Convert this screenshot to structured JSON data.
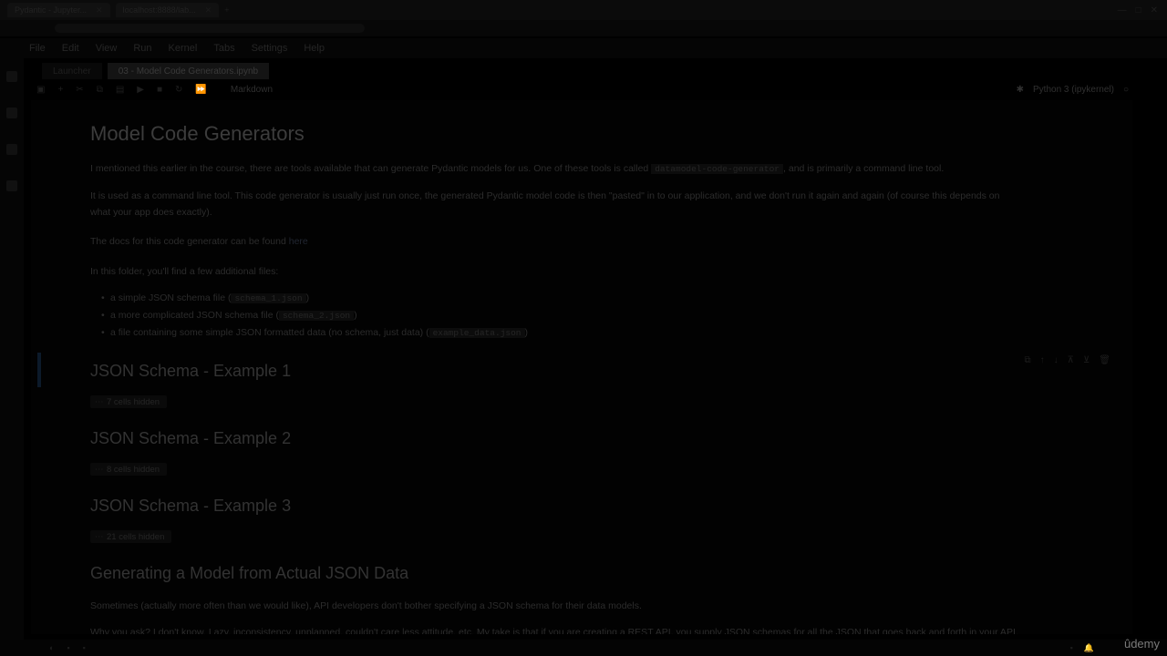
{
  "browser": {
    "tabs": [
      {
        "label": "Pydantic - Jupyter..."
      },
      {
        "label": "localhost:8888/lab..."
      }
    ]
  },
  "menu": {
    "items": [
      "File",
      "Edit",
      "View",
      "Run",
      "Kernel",
      "Tabs",
      "Settings",
      "Help"
    ]
  },
  "doc_tabs": [
    {
      "label": "Launcher"
    },
    {
      "label": "03 - Model Code Generators.ipynb"
    }
  ],
  "toolbar": {
    "cell_type": "Markdown",
    "kernel": "Python 3 (ipykernel)"
  },
  "notebook": {
    "title": "Model Code Generators",
    "p1_a": "I mentioned this earlier in the course, there are tools available that can generate Pydantic models for us. One of these tools is called",
    "p1_code": "datamodel-code-generator",
    "p1_b": ", and is primarily a command line tool.",
    "p2_line1": "It is used as a command line tool. This code generator is usually just run once, the generated Pydantic model code is then \"pasted\" in to our application, and we don't run it again and again (of course this depends on",
    "p2_line2": "what your app does exactly).",
    "p3_text": "The docs for this code generator can be found",
    "p3_link": "here",
    "p4": "In this folder, you'll find a few additional files:",
    "files": [
      {
        "text": "a simple JSON schema file (",
        "code": "schema_1.json",
        "end": ")"
      },
      {
        "text": "a more complicated JSON schema file (",
        "code": "schema_2.json",
        "end": ")"
      },
      {
        "text": "a file containing some simple JSON formatted data (no schema, just data) (",
        "code": "example_data.json",
        "end": ")"
      }
    ],
    "sections": [
      {
        "heading": "JSON Schema - Example 1",
        "hidden": "7 cells hidden"
      },
      {
        "heading": "JSON Schema - Example 2",
        "hidden": "8 cells hidden"
      },
      {
        "heading": "JSON Schema - Example 3",
        "hidden": "21 cells hidden"
      }
    ],
    "h_generating": "Generating a Model from Actual JSON Data",
    "p5": "Sometimes (actually more often than we would like), API developers don't bother specifying a JSON schema for their data models.",
    "p6": "Why you ask? I don't know. Lazy, inconsistency, unplanned, couldn't care less attitude, etc. My take is that if you are creating a REST API, you supply JSON schemas for all the JSON that goes back and forth in your API."
  },
  "watermark": "ûdemy"
}
